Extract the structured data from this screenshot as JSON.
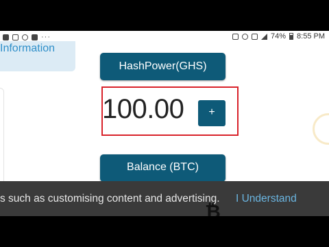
{
  "status_bar": {
    "battery_percent": 74,
    "battery_label": "74%",
    "time": "8:55 PM",
    "left_icons": [
      "message-icon",
      "chat-icon",
      "cast-icon",
      "youtube-icon"
    ],
    "right_icons": [
      "cast-icon",
      "no-sound-icon",
      "lte-icon",
      "signal-icon",
      "battery-icon"
    ]
  },
  "info_panel": {
    "label": "Information"
  },
  "hashpower": {
    "label": "HashPower(GHS)",
    "value": "100.00",
    "plus_label": "+"
  },
  "balance": {
    "label": "Balance (BTC)"
  },
  "cookie_banner": {
    "text": "s such as customising content and advertising.",
    "accept_label": "I Understand"
  },
  "colors": {
    "primary_button": "#0e5a78",
    "highlight_border": "#d9222a",
    "info_text": "#2f8fc9",
    "info_bg": "#dcebf5",
    "banner_bg": "#3a3a3a",
    "banner_link": "#6bb6e2"
  },
  "logo": {
    "glyph": "₿"
  }
}
